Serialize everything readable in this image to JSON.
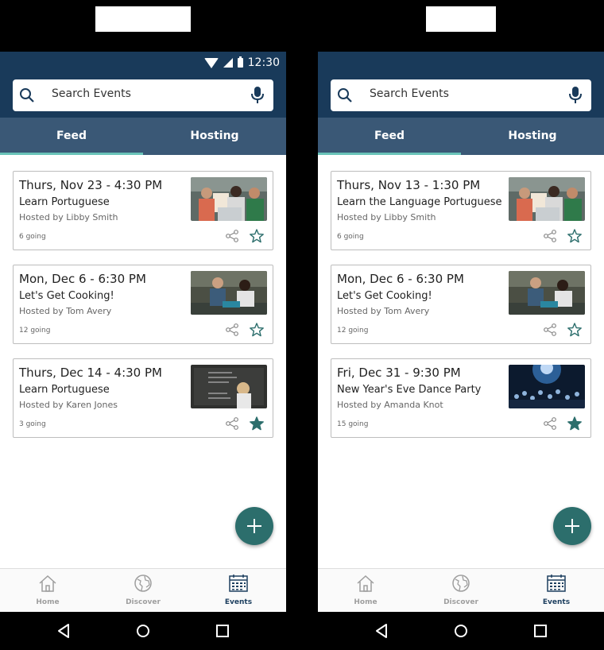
{
  "search": {
    "placeholder": "Search Events"
  },
  "status": {
    "time": "12:30"
  },
  "tabs": {
    "feed": "Feed",
    "hosting": "Hosting"
  },
  "nav": {
    "home": "Home",
    "discover": "Discover",
    "events": "Events"
  },
  "colors": {
    "appbar": "#193a5a",
    "tabs": "#3a5876",
    "accent": "#69c3b9",
    "fab": "#2c6e6c",
    "star": "#2c6e6c"
  },
  "icons": {
    "search": "search-icon",
    "mic": "mic-icon",
    "share": "share-icon",
    "star": "star-icon",
    "add": "plus-icon",
    "home": "home-icon",
    "discover": "globe-icon",
    "events": "calendar-icon"
  },
  "left": {
    "events": [
      {
        "date": "Thurs, Nov 23 - 4:30 PM",
        "title": "Learn Portuguese",
        "host": "Hosted by Libby Smith",
        "going": "6 going",
        "starred": false
      },
      {
        "date": "Mon, Dec 6 - 6:30 PM",
        "title": "Let's Get Cooking!",
        "host": "Hosted by Tom Avery",
        "going": "12 going",
        "starred": false
      },
      {
        "date": "Thurs, Dec 14 - 4:30 PM",
        "title": "Learn Portuguese",
        "host": "Hosted by Karen Jones",
        "going": "3 going",
        "starred": true
      }
    ]
  },
  "right": {
    "events": [
      {
        "date": "Thurs, Nov 13 - 1:30 PM",
        "title": "Learn the Language Portuguese",
        "host": "Hosted by Libby Smith",
        "going": "6 going",
        "starred": false
      },
      {
        "date": "Mon, Dec 6 - 6:30 PM",
        "title": "Let's Get Cooking!",
        "host": "Hosted by Tom Avery",
        "going": "12 going",
        "starred": false
      },
      {
        "date": "Fri, Dec 31 - 9:30 PM",
        "title": "New Year's Eve Dance Party",
        "host": "Hosted by Amanda Knot",
        "going": "15 going",
        "starred": true
      }
    ]
  }
}
